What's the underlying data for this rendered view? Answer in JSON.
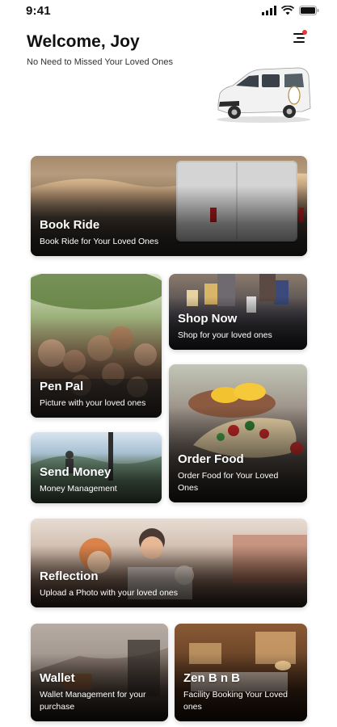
{
  "status_bar": {
    "time": "9:41",
    "icons": [
      "signal-icon",
      "wifi-icon",
      "battery-icon"
    ]
  },
  "header": {
    "title": "Welcome, Joy",
    "subtitle": "No Need to Missed Your Loved Ones",
    "menu_icon": "menu-icon",
    "notification_dot_color": "#e53935"
  },
  "cards": {
    "book_ride": {
      "title": "Book Ride",
      "subtitle": "Book Ride for Your Loved Ones"
    },
    "pen_pal": {
      "title": "Pen Pal",
      "subtitle": "Picture with your loved ones"
    },
    "shop_now": {
      "title": "Shop Now",
      "subtitle": "Shop for your loved ones"
    },
    "order_food": {
      "title": "Order Food",
      "subtitle": "Order Food for Your Loved Ones"
    },
    "send_money": {
      "title": "Send Money",
      "subtitle": "Money Management"
    },
    "reflection": {
      "title": "Reflection",
      "subtitle": "Upload a Photo with your loved ones"
    },
    "wallet": {
      "title": "Wallet",
      "subtitle": "Wallet Management for your purchase"
    },
    "zen_bnb": {
      "title": "Zen B n B",
      "subtitle": "Facility Booking Your Loved ones"
    }
  }
}
